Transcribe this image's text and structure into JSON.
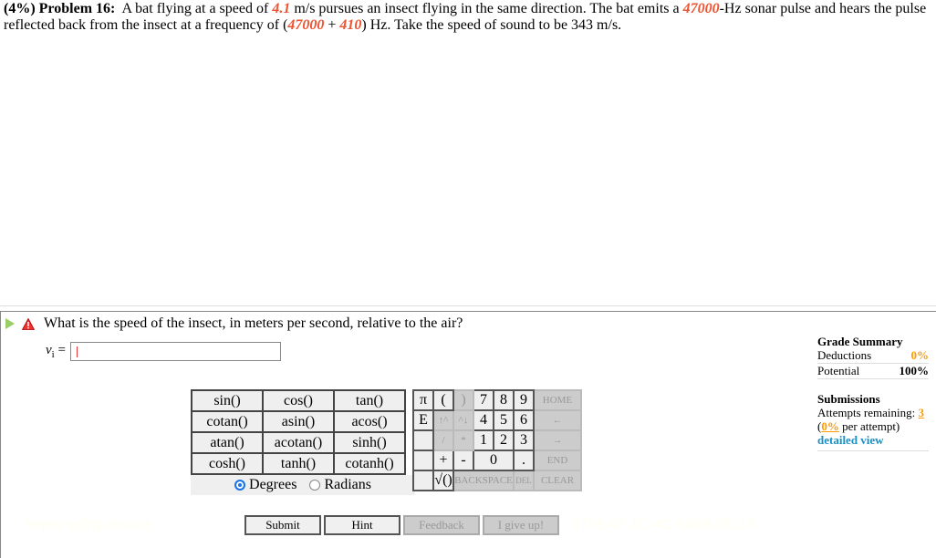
{
  "problem": {
    "weight": "(4%)",
    "label": "Problem 16:",
    "text_1": "A bat flying at a speed of ",
    "bat_speed": "4.1",
    "text_2": " m/s pursues an insect flying in the same direction. The bat emits a ",
    "emit_freq": "47000",
    "text_3": "-Hz sonar pulse and hears the pulse reflected back from the insect at a frequency of (",
    "refl_base": "47000",
    "plus": " + ",
    "refl_delta": "410",
    "text_4": ") Hz. Take the speed of sound to be 343 m/s."
  },
  "question": {
    "text": "What is the speed of the insect, in meters per second, relative to the air?",
    "answer_label": "v",
    "answer_sub": "i",
    "answer_eq": " =",
    "answer_value": ""
  },
  "grade_summary": {
    "title": "Grade Summary",
    "deductions_label": "Deductions",
    "deductions_value": "0%",
    "potential_label": "Potential",
    "potential_value": "100%",
    "submissions_title": "Submissions",
    "attempts_label": "Attempts remaining: ",
    "attempts_value": "3",
    "per_attempt_open": "(",
    "per_attempt_value": "0%",
    "per_attempt_text": " per attempt)",
    "detailed_view": "detailed view"
  },
  "calculator": {
    "functions": [
      [
        "sin()",
        "cos()",
        "tan()"
      ],
      [
        "cotan()",
        "asin()",
        "acos()"
      ],
      [
        "atan()",
        "acotan()",
        "sinh()"
      ],
      [
        "cosh()",
        "tanh()",
        "cotanh()"
      ]
    ],
    "degrees_label": "Degrees",
    "radians_label": "Radians",
    "mode": "Degrees",
    "keys": {
      "pi": "π",
      "open_paren": "(",
      "close_paren": ")",
      "seven": "7",
      "eight": "8",
      "nine": "9",
      "home": "HOME",
      "e": "E",
      "up_pow": "↑^",
      "pow_down": "^↓",
      "four": "4",
      "five": "5",
      "six": "6",
      "left": "←",
      "divide": "/",
      "multiply": "*",
      "one": "1",
      "two": "2",
      "three": "3",
      "right": "→",
      "plus": "+",
      "minus": "-",
      "zero": "0",
      "dot": ".",
      "end": "END",
      "sqrt": "√()",
      "backspace": "BACKSPACE",
      "del": "DEL",
      "clear": "CLEAR"
    }
  },
  "buttons": {
    "submit": "Submit",
    "hint": "Hint",
    "feedback": "Feedback",
    "give_up": "I give up!"
  },
  "watermark": {
    "left": "hejeung@g.sestina",
    "right": "5T98-47-1C-4C-8880-38113"
  }
}
